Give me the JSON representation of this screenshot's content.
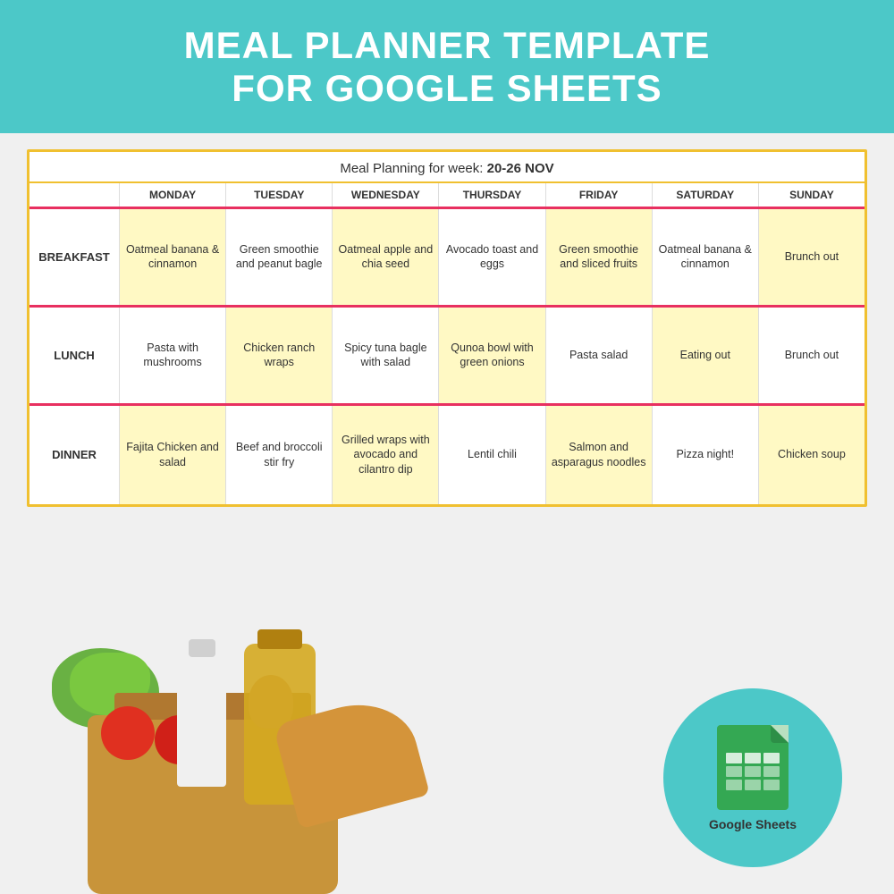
{
  "title": {
    "line1": "MEAL PLANNER TEMPLATE",
    "line2": "for GOOGLE SHEETS"
  },
  "table": {
    "week_label": "Meal Planning for week:",
    "week_dates": "20-26 NOV",
    "days": [
      "MONDAY",
      "TUESDAY",
      "WEDNESDAY",
      "THURSDAY",
      "FRIDAY",
      "SATURDAY",
      "SUNDAY"
    ],
    "meals": [
      {
        "label": "BREAKFAST",
        "items": [
          "Oatmeal banana & cinnamon",
          "Green smoothie and peanut bagle",
          "Oatmeal apple and chia seed",
          "Avocado toast and eggs",
          "Green smoothie and sliced fruits",
          "Oatmeal banana & cinnamon",
          "Brunch out"
        ],
        "colors": [
          "yellow",
          "white",
          "yellow",
          "white",
          "yellow",
          "white",
          "yellow"
        ]
      },
      {
        "label": "LUNCH",
        "items": [
          "Pasta with mushrooms",
          "Chicken ranch wraps",
          "Spicy tuna bagle with salad",
          "Qunoa bowl with green onions",
          "Pasta salad",
          "Eating out",
          "Brunch out"
        ],
        "colors": [
          "white",
          "yellow",
          "white",
          "yellow",
          "white",
          "yellow",
          "white"
        ]
      },
      {
        "label": "DINNER",
        "items": [
          "Fajita Chicken and salad",
          "Beef and broccoli stir fry",
          "Grilled wraps with avocado and cilantro dip",
          "Lentil chili",
          "Salmon and asparagus noodles",
          "Pizza night!",
          "Chicken soup"
        ],
        "colors": [
          "yellow",
          "white",
          "yellow",
          "white",
          "yellow",
          "white",
          "yellow"
        ]
      }
    ]
  },
  "google_sheets": {
    "label": "Google Sheets"
  }
}
